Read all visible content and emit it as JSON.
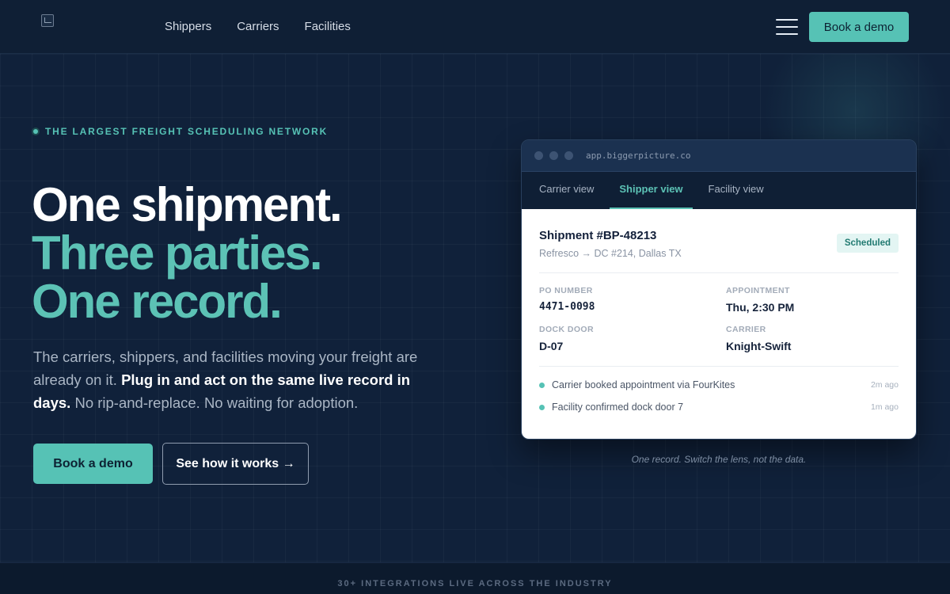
{
  "header": {
    "nav": [
      "Shippers",
      "Carriers",
      "Facilities"
    ],
    "cta": "Book a demo"
  },
  "hero": {
    "eyebrow": "THE LARGEST FREIGHT SCHEDULING NETWORK",
    "headline": [
      "One shipment.",
      "Three parties.",
      "One record."
    ],
    "sub_pre": "The carriers, shippers, and facilities moving your freight are already on it. ",
    "sub_bold": "Plug in and act on the same live record in days.",
    "sub_post": " No rip-and-replace. No waiting for adoption.",
    "primary_button": "Book a demo",
    "secondary_button": "See how it works →"
  },
  "app": {
    "url": "app.biggerpicture.co",
    "tabs": [
      "Carrier view",
      "Shipper view",
      "Facility view"
    ],
    "active_tab": "Shipper view",
    "shipment": {
      "title": "Shipment #BP-48213",
      "route": "Refresco → DC #214, Dallas TX",
      "status": "Scheduled"
    },
    "fields": [
      {
        "label": "PO NUMBER",
        "value": "4471-0098"
      },
      {
        "label": "APPOINTMENT",
        "value": "Thu, 2:30 PM"
      },
      {
        "label": "DOCK DOOR",
        "value": "D-07"
      },
      {
        "label": "CARRIER",
        "value": "Knight-Swift"
      }
    ],
    "activity": [
      {
        "text": "Carrier booked appointment via FourKites",
        "time": "2m ago"
      },
      {
        "text": "Facility confirmed dock door 7",
        "time": "1m ago"
      }
    ],
    "caption": "One record. Switch the lens, not the data."
  },
  "strip": {
    "text": "30+ INTEGRATIONS LIVE ACROSS THE INDUSTRY"
  },
  "colors": {
    "background": "#0f1f35",
    "accent": "#56c2b5",
    "card": "#ffffff"
  }
}
